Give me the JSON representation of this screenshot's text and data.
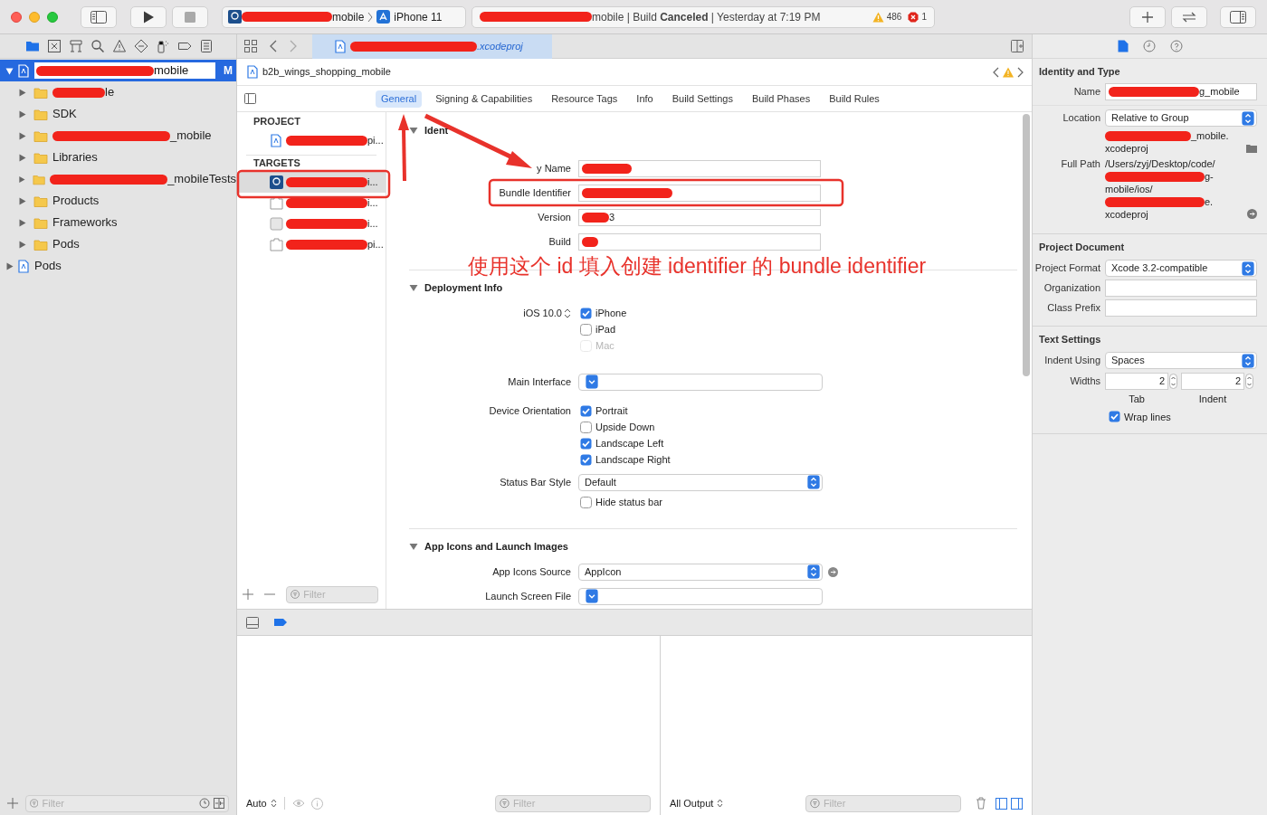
{
  "toolbar": {
    "scheme": {
      "target": "mobile",
      "device": "iPhone 11"
    },
    "activity": {
      "text": "mobile | Build **Canceled** | Yesterday at 7:19 PM",
      "warnings": "486",
      "errors": "1"
    }
  },
  "navigator": {
    "tree": [
      {
        "label": "mobile",
        "kind": "project",
        "redacted": true,
        "selected": true,
        "expanded": true,
        "badge": "M",
        "children": [
          {
            "label": "le",
            "kind": "folder",
            "redacted": true,
            "selected": false,
            "expanded": false
          },
          {
            "label": "SDK",
            "kind": "folder",
            "redacted": false,
            "selected": false,
            "expanded": false
          },
          {
            "label": "_mobile",
            "kind": "folder",
            "redacted": true,
            "selected": false,
            "expanded": false
          },
          {
            "label": "Libraries",
            "kind": "folder",
            "redacted": false,
            "selected": false,
            "expanded": false
          },
          {
            "label": "_mobileTests",
            "kind": "folder",
            "redacted": true,
            "selected": false,
            "expanded": false
          },
          {
            "label": "Products",
            "kind": "folder",
            "redacted": false,
            "selected": false,
            "expanded": false
          },
          {
            "label": "Frameworks",
            "kind": "folder",
            "redacted": false,
            "selected": false,
            "expanded": false
          },
          {
            "label": "Pods",
            "kind": "folder",
            "redacted": false,
            "selected": false,
            "expanded": false
          }
        ]
      },
      {
        "label": "Pods",
        "kind": "project",
        "redacted": false,
        "selected": false,
        "expanded": false
      }
    ],
    "filter_placeholder": "Filter"
  },
  "editor": {
    "tab": {
      "label": ".xcodeproj",
      "redacted": true
    },
    "jump_bar": "b2b_wings_shopping_mobile",
    "tabs": [
      {
        "label": "General",
        "selected": true
      },
      {
        "label": "Signing & Capabilities",
        "selected": false
      },
      {
        "label": "Resource Tags",
        "selected": false
      },
      {
        "label": "Info",
        "selected": false
      },
      {
        "label": "Build Settings",
        "selected": false
      },
      {
        "label": "Build Phases",
        "selected": false
      },
      {
        "label": "Build Rules",
        "selected": false
      }
    ],
    "targets": {
      "sections": [
        {
          "title": "PROJECT",
          "items": [
            {
              "label": "pi...",
              "kind": "project",
              "selected": false
            }
          ]
        },
        {
          "title": "TARGETS",
          "items": [
            {
              "label": "i...",
              "kind": "app",
              "selected": true
            },
            {
              "label": "i...",
              "kind": "bundle",
              "selected": false
            },
            {
              "label": "i...",
              "kind": "extension",
              "selected": false
            },
            {
              "label": "pi...",
              "kind": "bundle",
              "selected": false
            }
          ]
        }
      ],
      "filter_placeholder": "Filter"
    },
    "sections": [
      {
        "title": "Ident",
        "rows": [
          {
            "kind": "field",
            "label": "y Name",
            "redacted": true
          },
          {
            "kind": "field",
            "label": "Bundle Identifier",
            "redacted": true
          },
          {
            "kind": "field",
            "label": "Version",
            "value": "3",
            "redacted": true
          },
          {
            "kind": "field",
            "label": "Build",
            "redacted": true
          }
        ]
      },
      {
        "title": "Deployment Info",
        "rows": [
          {
            "kind": "checks",
            "label": "iOS 10.0",
            "stepper": true,
            "items": [
              {
                "label": "iPhone",
                "checked": true,
                "disabled": false
              },
              {
                "label": "iPad",
                "checked": false,
                "disabled": false
              },
              {
                "label": "Mac",
                "checked": false,
                "disabled": true
              }
            ]
          },
          {
            "kind": "combo",
            "label": "Main Interface"
          },
          {
            "kind": "checks",
            "label": "Device Orientation",
            "stepper": false,
            "items": [
              {
                "label": "Portrait",
                "checked": true,
                "disabled": false
              },
              {
                "label": "Upside Down",
                "checked": false,
                "disabled": false
              },
              {
                "label": "Landscape Left",
                "checked": true,
                "disabled": false
              },
              {
                "label": "Landscape Right",
                "checked": true,
                "disabled": false
              }
            ]
          },
          {
            "kind": "popup",
            "label": "Status Bar Style",
            "value": "Default"
          },
          {
            "kind": "checks",
            "stepper": false,
            "items": [
              {
                "label": "Hide status bar",
                "checked": false,
                "disabled": false
              }
            ]
          }
        ]
      },
      {
        "title": "App Icons and Launch Images",
        "rows": [
          {
            "kind": "popup",
            "label": "App Icons Source",
            "value": "AppIcon",
            "go_button": true
          },
          {
            "kind": "combo",
            "label": "Launch Screen File"
          }
        ]
      }
    ]
  },
  "debug": {
    "left": {
      "mode": "Auto",
      "filter_placeholder": "Filter"
    },
    "right": {
      "mode": "All Output",
      "filter_placeholder": "Filter"
    }
  },
  "inspector": {
    "sections": [
      {
        "title": "Identity and Type",
        "rows": [
          {
            "kind": "field",
            "label": "Name",
            "value": "g_mobile",
            "redacted": true
          },
          {
            "kind": "popup",
            "label": "Location",
            "value": "Relative to Group"
          },
          {
            "kind": "path",
            "lines": [
              {
                "text": "_mobile.",
                "redacted": true
              },
              {
                "text": "xcodeproj",
                "redacted": false
              }
            ],
            "folder_button": true
          },
          {
            "kind": "path",
            "label": "Full Path",
            "lines": [
              {
                "text": "/Users/zyj/Desktop/code/",
                "redacted": false
              },
              {
                "text": "g-",
                "redacted": true
              },
              {
                "text": "mobile/ios/",
                "redacted": false
              },
              {
                "text": "e.",
                "redacted": true
              },
              {
                "text": "xcodeproj",
                "redacted": false
              }
            ],
            "reveal_button": true
          }
        ]
      },
      {
        "title": "Project Document",
        "rows": [
          {
            "kind": "popup",
            "label": "Project Format",
            "value": "Xcode 3.2-compatible"
          },
          {
            "kind": "field",
            "label": "Organization",
            "redacted": false
          },
          {
            "kind": "field",
            "label": "Class Prefix",
            "redacted": false
          }
        ]
      },
      {
        "title": "Text Settings",
        "rows": [
          {
            "kind": "popup",
            "label": "Indent Using",
            "value": "Spaces"
          },
          {
            "kind": "widths",
            "label": "Widths",
            "fields": [
              {
                "value": "2",
                "caption": "Tab"
              },
              {
                "value": "2",
                "caption": "Indent"
              }
            ]
          },
          {
            "kind": "check",
            "label": "Wrap lines",
            "checked": true
          }
        ]
      }
    ]
  },
  "annotation": {
    "note": "使用这个 id 填入创建 identifier 的 bundle identifier"
  }
}
